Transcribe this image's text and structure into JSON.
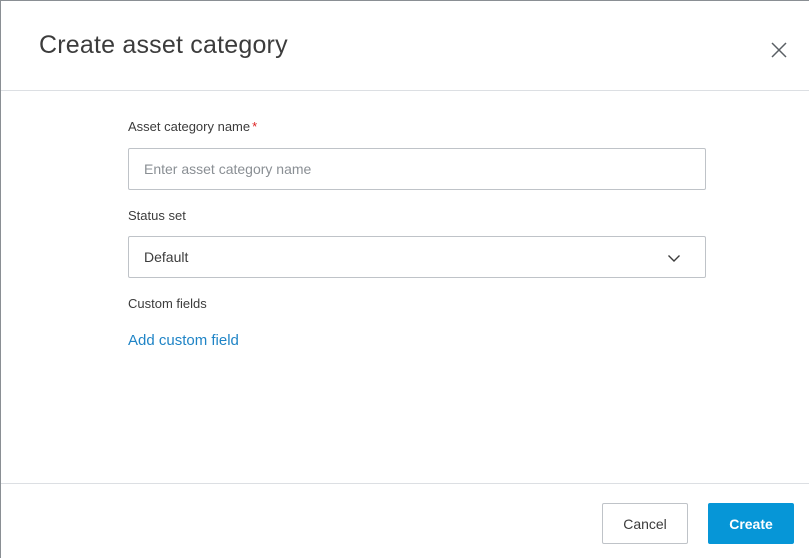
{
  "dialog": {
    "title": "Create asset category",
    "close_icon": "close-icon"
  },
  "form": {
    "name_label": "Asset category name",
    "required_marker": "*",
    "name_placeholder": "Enter asset category name",
    "name_value": "",
    "status_set_label": "Status set",
    "status_set_value": "Default",
    "status_set_icon": "chevron-down-icon",
    "custom_fields_label": "Custom fields",
    "add_custom_field_link": "Add custom field"
  },
  "footer": {
    "cancel_label": "Cancel",
    "create_label": "Create"
  },
  "colors": {
    "accent": "#0696d7",
    "link": "#1f84c6",
    "required": "#dd2222"
  }
}
